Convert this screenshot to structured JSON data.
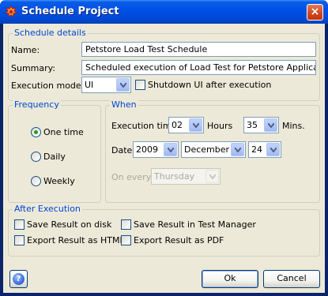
{
  "window": {
    "title": "Schedule Project",
    "close_glyph": "×"
  },
  "schedule_details": {
    "legend": "Schedule details",
    "name_label": "Name:",
    "name_value": "Petstore Load Test Schedule",
    "summary_label": "Summary:",
    "summary_value": "Scheduled execution of Load Test for Petstore Application",
    "mode_label": "Execution mode:",
    "mode_value": "UI",
    "shutdown_label": "Shutdown UI after execution",
    "shutdown_checked": false
  },
  "frequency": {
    "legend": "Frequency",
    "options": [
      {
        "label": "One time",
        "checked": true
      },
      {
        "label": "Daily",
        "checked": false
      },
      {
        "label": "Weekly",
        "checked": false
      }
    ]
  },
  "when": {
    "legend": "When",
    "exec_time_label": "Execution time",
    "hours_value": "02",
    "hours_label": "Hours",
    "mins_value": "35",
    "mins_label": "Mins.",
    "date_label": "Date",
    "year_value": "2009",
    "month_value": "December",
    "day_value": "24",
    "on_every_label": "On every",
    "weekday_value": "Thursday"
  },
  "after_execution": {
    "legend": "After Execution",
    "options": [
      {
        "label": "Save Result on disk",
        "checked": false
      },
      {
        "label": "Save Result in Test Manager",
        "checked": false
      },
      {
        "label": "Export Result as HTML",
        "checked": false
      },
      {
        "label": "Export Result as PDF",
        "checked": false
      }
    ]
  },
  "buttons": {
    "help_glyph": "?",
    "ok": "Ok",
    "cancel": "Cancel"
  },
  "colors": {
    "titlebar": "#0052e6",
    "dialog_bg": "#ece9d8",
    "legend_text": "#0046d5",
    "close_button": "#d4481d"
  },
  "icons": {
    "app": "schedule-app-icon",
    "close": "close-icon",
    "help": "help-icon",
    "dropdown": "chevron-down-icon"
  }
}
